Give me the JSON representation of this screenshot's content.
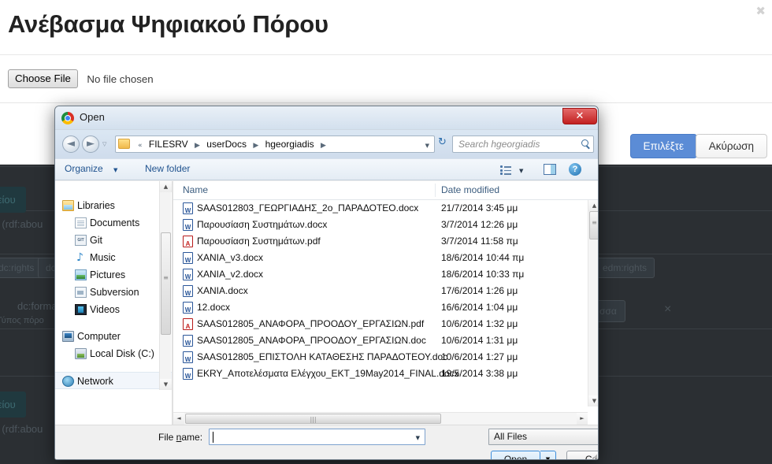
{
  "page": {
    "title": "Ανέβασμα Ψηφιακού Πόρου",
    "close_label": "✖",
    "choose_file_label": "Choose File",
    "no_file_label": "No file chosen",
    "primary_button": "Επιλέξτε",
    "secondary_button": "Ακύρωση",
    "background_chips": [
      "dc:rights",
      "dc:",
      "edm:rights"
    ],
    "background_buttons": [
      "αρχείου",
      "αρχείου"
    ],
    "background_texts": [
      "L (rdf:abou",
      "L (rdf:abou",
      "dc:forma",
      "Τύπος πόρο"
    ],
    "background_select": "σσα",
    "background_remove": "×",
    "accent_color": "#5b8cd6",
    "overlay_color": "#2b2f33"
  },
  "dialog": {
    "title": "Open",
    "app_icon": "chrome-logo-icon",
    "close_button": "✕",
    "nav": {
      "back_label": "◄",
      "forward_label": "►",
      "history_dropdown": "▽",
      "breadcrumb_prefix": "«",
      "breadcrumb": [
        "FILESRV",
        "userDocs",
        "hgeorgiadis"
      ],
      "breadcrumb_sep": "▶",
      "address_dropdown": "▼",
      "refresh_label": "↻",
      "search_placeholder": "Search hgeorgiadis"
    },
    "toolbar": {
      "organize_label": "Organize",
      "organize_caret": "▼",
      "new_folder_label": "New folder",
      "view_caret": "▼",
      "help_label": "?"
    },
    "sidebar": [
      {
        "label": "Libraries",
        "icon": "libraries-icon",
        "level": 0,
        "selected": false
      },
      {
        "label": "Documents",
        "icon": "documents-icon",
        "level": 1,
        "selected": false
      },
      {
        "label": "Git",
        "icon": "git-icon",
        "level": 1,
        "selected": false
      },
      {
        "label": "Music",
        "icon": "music-icon",
        "level": 1,
        "selected": false
      },
      {
        "label": "Pictures",
        "icon": "pictures-icon",
        "level": 1,
        "selected": false
      },
      {
        "label": "Subversion",
        "icon": "subversion-icon",
        "level": 1,
        "selected": false
      },
      {
        "label": "Videos",
        "icon": "videos-icon",
        "level": 1,
        "selected": false
      },
      {
        "label": "",
        "icon": "",
        "level": -1,
        "selected": false
      },
      {
        "label": "Computer",
        "icon": "computer-icon",
        "level": 0,
        "selected": false
      },
      {
        "label": "Local Disk (C:)",
        "icon": "disk-icon",
        "level": 1,
        "selected": false
      },
      {
        "label": "",
        "icon": "",
        "level": -1,
        "selected": false
      },
      {
        "label": "Network",
        "icon": "network-icon",
        "level": 0,
        "selected": true
      }
    ],
    "columns": {
      "name": "Name",
      "date_modified": "Date modified"
    },
    "files": [
      {
        "name": "SAAS012803_ΓΕΩΡΓΙΑΔΗΣ_2ο_ΠΑΡΑΔΟΤΕΟ.docx",
        "date": "21/7/2014 3:45 μμ",
        "type": "word"
      },
      {
        "name": "Παρουσίαση Συστημάτων.docx",
        "date": "3/7/2014 12:26 μμ",
        "type": "word"
      },
      {
        "name": "Παρουσίαση Συστημάτων.pdf",
        "date": "3/7/2014 11:58 πμ",
        "type": "pdf"
      },
      {
        "name": "XANIA_v3.docx",
        "date": "18/6/2014 10:44 πμ",
        "type": "word"
      },
      {
        "name": "XANIA_v2.docx",
        "date": "18/6/2014 10:33 πμ",
        "type": "word"
      },
      {
        "name": "XANIA.docx",
        "date": "17/6/2014 1:26 μμ",
        "type": "word"
      },
      {
        "name": "12.docx",
        "date": "16/6/2014 1:04 μμ",
        "type": "word"
      },
      {
        "name": "SAAS012805_ΑΝΑΦΟΡΑ_ΠΡΟΟΔΟΥ_ΕΡΓΑΣΙΩΝ.pdf",
        "date": "10/6/2014 1:32 μμ",
        "type": "pdf"
      },
      {
        "name": "SAAS012805_ΑΝΑΦΟΡΑ_ΠΡΟΟΔΟΥ_ΕΡΓΑΣΙΩΝ.doc",
        "date": "10/6/2014 1:31 μμ",
        "type": "word"
      },
      {
        "name": "SAAS012805_ΕΠΙΣΤΟΛΗ ΚΑΤΑΘΕΣΗΣ ΠΑΡΑΔΟΤΕΟΥ.doc",
        "date": "10/6/2014 1:27 μμ",
        "type": "word"
      },
      {
        "name": "EKRY_Αποτελέσματα Ελέγχου_ΕΚΤ_19May2014_FINAL.docx",
        "date": "19/5/2014 3:38 μμ",
        "type": "word"
      }
    ],
    "footer": {
      "file_name_label": "File name:",
      "file_name_value": "",
      "filter_value": "All Files",
      "open_label": "Open",
      "open_split_caret": "▼",
      "cancel_label": "Cancel",
      "dropdown_caret": "▼"
    }
  }
}
